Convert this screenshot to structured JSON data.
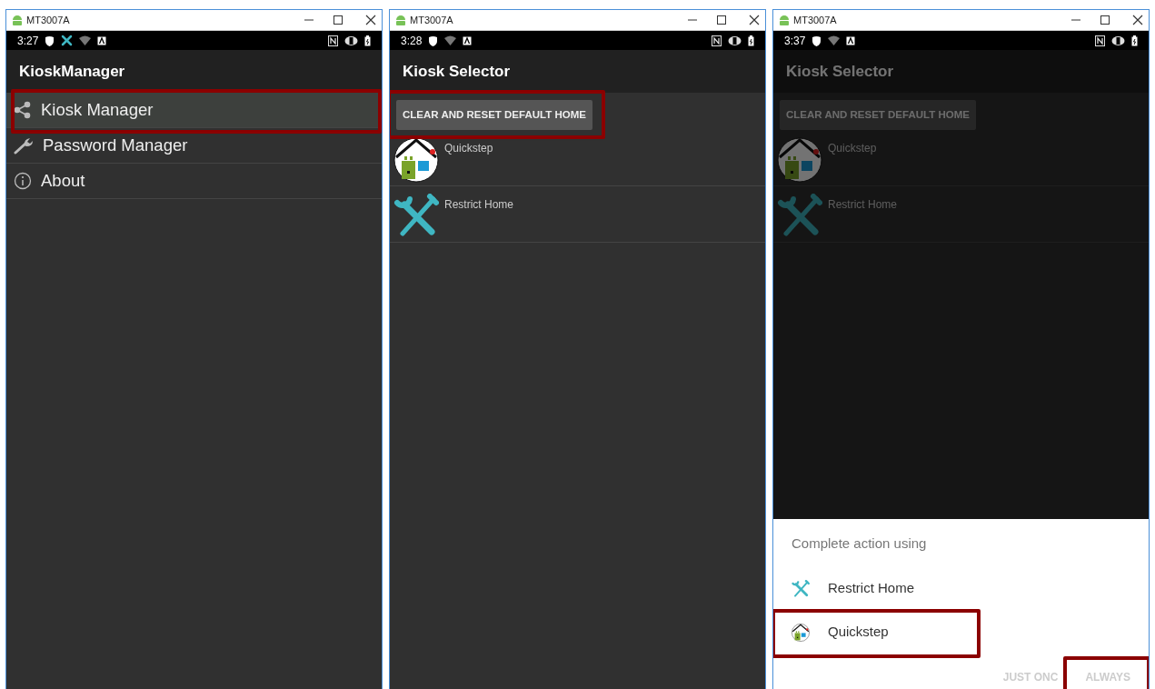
{
  "windows": [
    {
      "title": "MT3007A",
      "status": {
        "time": "3:27",
        "icons": [
          {
            "kind": "shield"
          },
          {
            "kind": "tools"
          },
          {
            "kind": "wifi"
          },
          {
            "kind": "abox"
          }
        ]
      },
      "screen": {
        "app_bar_title": "KioskManager",
        "menu": [
          {
            "label": "Kiosk Manager",
            "kind": "share",
            "selected": true,
            "highlighted": true
          },
          {
            "label": "Password Manager",
            "kind": "wrench",
            "selected": false
          },
          {
            "label": "About",
            "kind": "info",
            "selected": false
          }
        ]
      }
    },
    {
      "title": "MT3007A",
      "status": {
        "time": "3:28",
        "icons": [
          {
            "kind": "shield"
          },
          {
            "kind": "wifi"
          },
          {
            "kind": "abox"
          }
        ]
      },
      "screen": {
        "app_bar_title": "Kiosk Selector",
        "button": {
          "label": "CLEAR AND RESET DEFAULT HOME",
          "highlighted": true
        },
        "apps": [
          {
            "label": "Quickstep",
            "kind": "home"
          },
          {
            "label": "Restrict Home",
            "kind": "tools"
          }
        ]
      }
    },
    {
      "title": "MT3007A",
      "status": {
        "time": "3:37",
        "icons": [
          {
            "kind": "shield"
          },
          {
            "kind": "wifi"
          },
          {
            "kind": "abox"
          }
        ]
      },
      "screen": {
        "dimmed": true,
        "app_bar_title": "Kiosk Selector",
        "button": {
          "label": "CLEAR AND RESET DEFAULT HOME"
        },
        "apps": [
          {
            "label": "Quickstep",
            "kind": "home"
          },
          {
            "label": "Restrict Home",
            "kind": "tools"
          }
        ],
        "dialog": {
          "title": "Complete action using",
          "options": [
            {
              "label": "Restrict Home",
              "kind": "tools"
            },
            {
              "label": "Quickstep",
              "kind": "home",
              "highlighted": true
            }
          ],
          "buttons": [
            {
              "label": "JUST ONC",
              "disabled": true
            },
            {
              "label": "ALWAYS",
              "disabled": true,
              "highlighted": true
            }
          ]
        }
      }
    }
  ]
}
